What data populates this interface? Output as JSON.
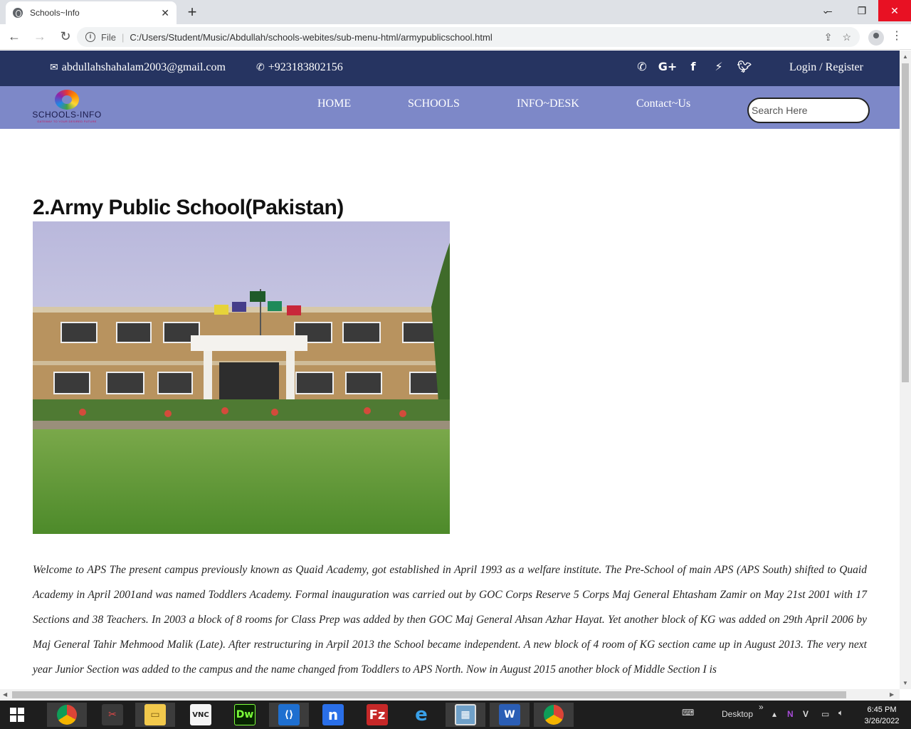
{
  "browser": {
    "tab_title": "Schools~Info",
    "tab_close": "✕",
    "new_tab": "+",
    "url_scheme": "File",
    "url": "C:/Users/Student/Music/Abdullah/schools-webites/sub-menu-html/armypublicschool.html"
  },
  "topbar": {
    "email": "abdullahshahalam2003@gmail.com",
    "phone": "+923183802156",
    "socials": [
      "viber",
      "google-plus",
      "facebook",
      "messenger",
      "twitter"
    ],
    "login": "Login / Register",
    "bg_color": "#263461"
  },
  "navbar": {
    "logo_name": "SCHOOLS-INFO",
    "logo_tagline": "GATEWAY TO YOUR DESIRED FUTURE",
    "menu": [
      "HOME",
      "SCHOOLS",
      "INFO~DESK",
      "Contact~Us"
    ],
    "search_placeholder": "Search Here",
    "bg_color": "#7d88c8"
  },
  "main": {
    "title": "2.Army Public School(Pakistan)",
    "paragraph": "Welcome to APS The present campus previously known as Quaid Academy, got established in April 1993 as a welfare institute. The Pre-School of main APS (APS South) shifted to Quaid Academy in April 2001and was named Toddlers Academy. Formal inauguration was carried out by GOC Corps Reserve 5 Corps Maj General Ehtasham Zamir on May 21st 2001 with 17 Sections and 38 Teachers. In 2003 a block of 8 rooms for Class Prep was added by then GOC Maj General Ahsan Azhar Hayat. Yet another block of KG was added on 29th April 2006 by Maj General Tahir Mehmood Malik (Late). After restructuring in Arpil 2013 the School became independent. A new block of 4 room of KG section came up in August 2013. The very next year Junior Section was added to the campus and the name changed from Toddlers to APS North. Now in August 2015 another block of Middle Section I is"
  },
  "taskbar": {
    "apps": [
      "Chrome",
      "Snipping Tool",
      "File Explorer",
      "VNC Viewer",
      "Dreamweaver",
      "Visual Studio Code",
      "Nimbus",
      "FileZilla",
      "Internet Explorer",
      "Photos",
      "Word",
      "Chrome"
    ],
    "desktop_label": "Desktop",
    "time": "6:45 PM",
    "date": "3/26/2022"
  }
}
